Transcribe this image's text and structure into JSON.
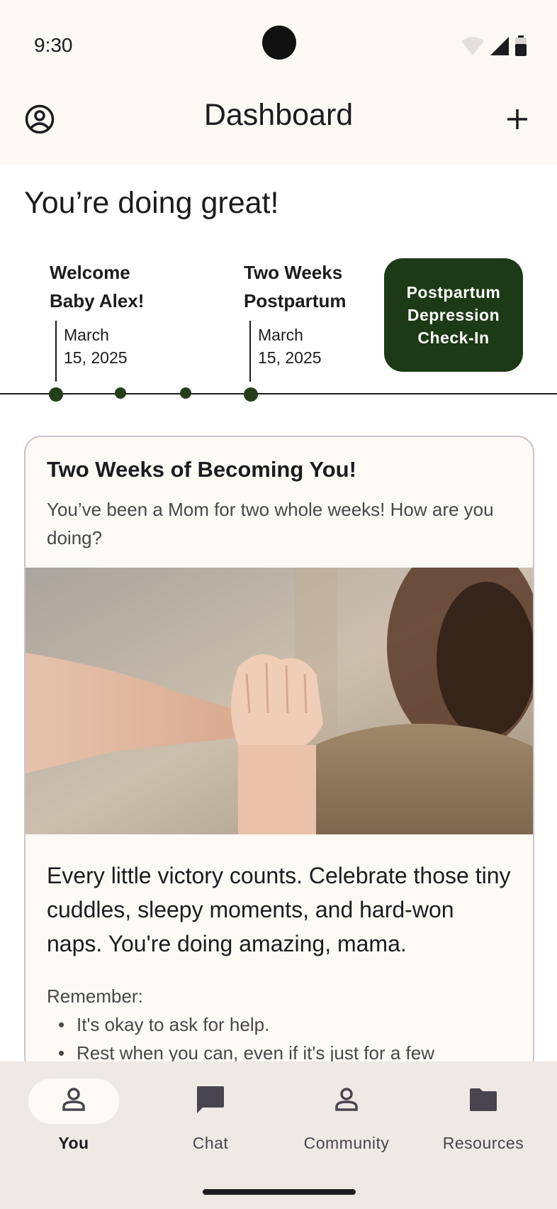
{
  "status_bar": {
    "time": "9:30"
  },
  "top_bar": {
    "title": "Dashboard"
  },
  "greeting": "You’re doing great!",
  "timeline": {
    "milestones": [
      {
        "title_line1": "Welcome",
        "title_line2": "Baby Alex!",
        "date_line1": "March",
        "date_line2": "15, 2025"
      },
      {
        "title_line1": "Two Weeks",
        "title_line2": "Postpartum",
        "date_line1": "March",
        "date_line2": "15, 2025"
      }
    ],
    "checkin_button": {
      "line1": "Postpartum",
      "line2": "Depression",
      "line3": "Check-In"
    }
  },
  "card": {
    "title": "Two Weeks of Becoming You!",
    "subtitle": "You’ve been a Mom for two whole weeks! How are you doing?",
    "body": "Every little victory counts. Celebrate those tiny cuddles, sleepy moments, and hard-won naps. You're doing amazing, mama.",
    "remember_label": "Remember:",
    "remember_items": [
      "It's okay to ask for help.",
      "Rest when you can, even if it's just for a few"
    ]
  },
  "bottom_nav": {
    "items": [
      {
        "label": "You",
        "icon": "person-icon",
        "active": true
      },
      {
        "label": "Chat",
        "icon": "chat-icon",
        "active": false
      },
      {
        "label": "Community",
        "icon": "person-icon",
        "active": false
      },
      {
        "label": "Resources",
        "icon": "folder-icon",
        "active": false
      }
    ]
  },
  "colors": {
    "surface": "#fcf8f3",
    "primary_dark": "#1c3a15",
    "nav_background": "#efe9e6",
    "card_background": "#fdfaf5"
  }
}
